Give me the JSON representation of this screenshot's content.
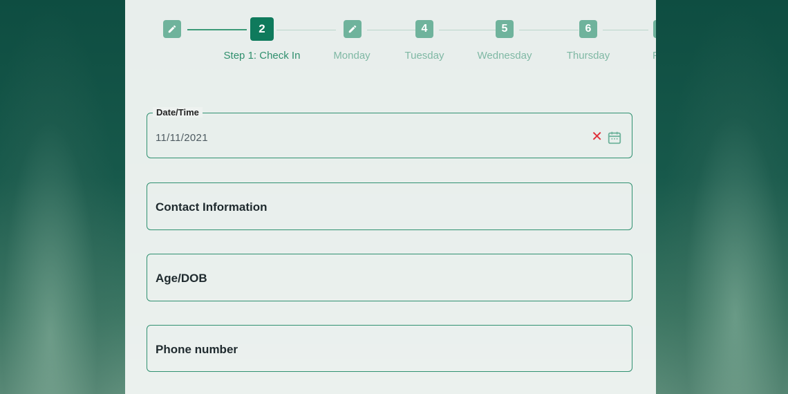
{
  "stepper": {
    "steps": [
      {
        "badge": "",
        "icon": "pencil-icon",
        "label": ""
      },
      {
        "badge": "2",
        "label": "Step 1: Check In",
        "active": true
      },
      {
        "badge": "",
        "icon": "pencil-icon",
        "label": "Monday"
      },
      {
        "badge": "4",
        "label": "Tuesday"
      },
      {
        "badge": "5",
        "label": "Wednesday"
      },
      {
        "badge": "6",
        "label": "Thursday"
      },
      {
        "badge": "",
        "label": "F"
      }
    ]
  },
  "form": {
    "datetime": {
      "legend": "Date/Time",
      "value": "11/11/2021",
      "clear_icon": "close-icon",
      "calendar_icon": "calendar-icon"
    },
    "contact": {
      "label": "Contact Information"
    },
    "age": {
      "label": "Age/DOB"
    },
    "phone": {
      "label": "Phone number"
    }
  },
  "colors": {
    "accent": "#0f7a5c",
    "step_inactive": "#6fb39c",
    "error": "#e0303a"
  }
}
